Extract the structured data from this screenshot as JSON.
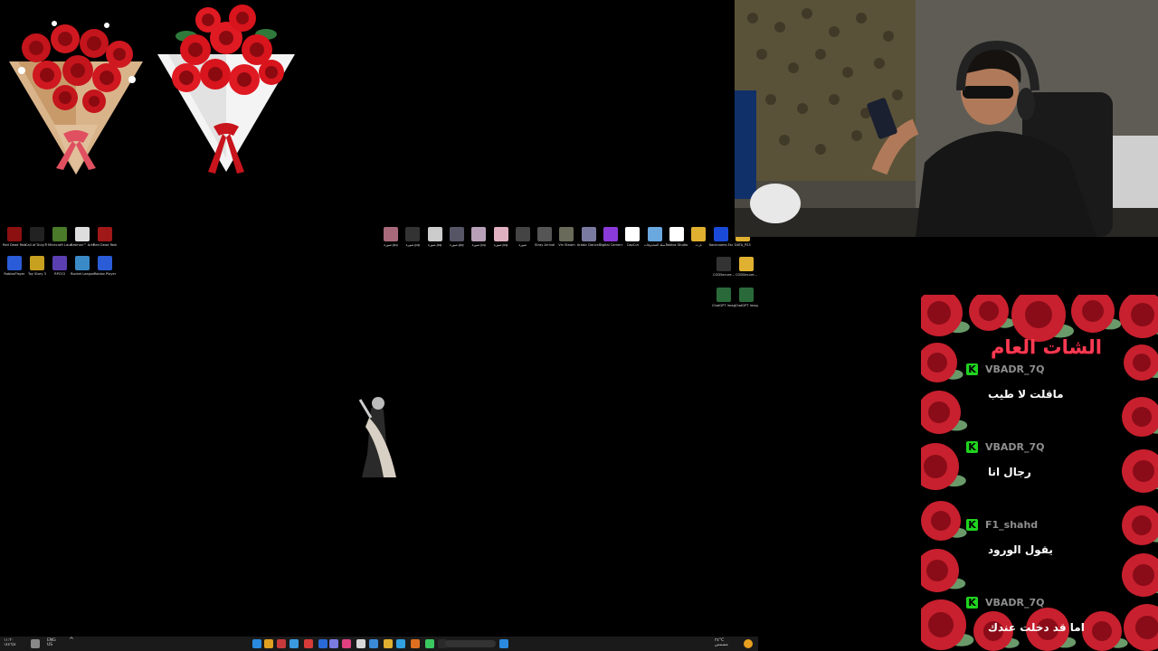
{
  "desktop": {
    "icons_left": [
      {
        "label": "Red Dead Redemption",
        "color": "#8b1010"
      },
      {
        "label": "Call of Duty® HQ",
        "color": "#222"
      },
      {
        "label": "Minecraft Launcher",
        "color": "#4a7a2a"
      },
      {
        "label": "Batman™ Arkham",
        "color": "#ddd"
      },
      {
        "label": "Red Dead Redemption",
        "color": "#a01818"
      },
      {
        "label": "RobloxPlayer",
        "color": "#2a5cd8"
      },
      {
        "label": "Toy Story 3",
        "color": "#c8a020"
      },
      {
        "label": "RPCS3",
        "color": "#5a3fb0"
      },
      {
        "label": "Rocket League®",
        "color": "#3a8ac8"
      },
      {
        "label": "Roblox Player",
        "color": "#2a5cd8"
      }
    ],
    "icons_right": [
      {
        "label": "صورة.jpg",
        "color": "#a86a7a"
      },
      {
        "label": "صورة.jpg",
        "color": "#333"
      },
      {
        "label": "صورة.jpg",
        "color": "#ccc"
      },
      {
        "label": "صورة.jpg",
        "color": "#556"
      },
      {
        "label": "صورة.jpg",
        "color": "#b8a0b8"
      },
      {
        "label": "صورة.jpg",
        "color": "#e0b0c0"
      },
      {
        "label": "صورة",
        "color": "#444"
      },
      {
        "label": "Stray Arrival",
        "color": "#555"
      },
      {
        "label": "Vin Steam",
        "color": "#6a6a5a"
      },
      {
        "label": "Arabic Dance GIF",
        "color": "#7a7aa0"
      },
      {
        "label": "Digital Camera Hub",
        "color": "#8a3ad8"
      },
      {
        "label": "CapCut",
        "color": "#fff"
      },
      {
        "label": "سلة المحذوفات",
        "color": "#6aa8e0"
      },
      {
        "label": "Roblox Studio",
        "color": "#fff"
      },
      {
        "label": "بارت",
        "color": "#e0b030"
      },
      {
        "label": "Backrooms Escape T...",
        "color": "#1a4ad8"
      },
      {
        "label": "DATA_PS3",
        "color": "#e0b030"
      }
    ],
    "icons_right_row2": [
      {
        "label": "CODSecure...",
        "color": "#333"
      },
      {
        "label": "CODSecure...",
        "color": "#e0b030"
      }
    ],
    "icons_right_row3": [
      {
        "label": "ChatGPT Image...",
        "color": "#2a6a3a"
      },
      {
        "label": "ChatGPT Image...",
        "color": "#2a6a3a"
      }
    ]
  },
  "chat": {
    "title": "الشات العام",
    "platform_badge": "K",
    "messages": [
      {
        "user": "VBADR_7Q",
        "text": "ماقلت لا طيب"
      },
      {
        "user": "VBADR_7Q",
        "text": "رجال انا"
      },
      {
        "user": "F1_shahd",
        "text": "يقول الورود"
      },
      {
        "user": "VBADR_7Q",
        "text": "اما قد دخلت عندك"
      }
    ],
    "accent_color": "#ff3a52",
    "badge_color": "#1fd41f"
  },
  "taskbar": {
    "left_time": "١١:٣٠",
    "left_date": "١٤٤٦/٨",
    "lang": "ENG",
    "lang_sub": "US",
    "weather_temp": "٣٤°C",
    "weather_desc": "مشمس"
  }
}
